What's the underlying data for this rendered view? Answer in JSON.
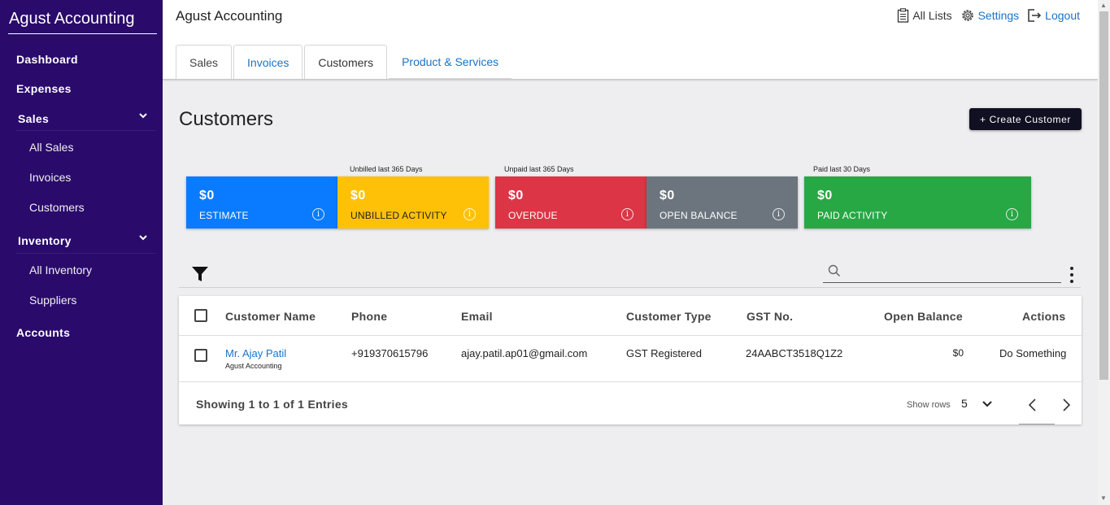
{
  "sidebar": {
    "brand": "Agust Accounting",
    "dashboard": "Dashboard",
    "expenses": "Expenses",
    "sales": {
      "label": "Sales",
      "items": [
        "All Sales",
        "Invoices",
        "Customers"
      ]
    },
    "inventory": {
      "label": "Inventory",
      "items": [
        "All Inventory",
        "Suppliers"
      ]
    },
    "accounts": "Accounts"
  },
  "header": {
    "title": "Agust Accounting",
    "all_lists": "All Lists",
    "settings": "Settings",
    "logout": "Logout",
    "tabs": [
      "Sales",
      "Invoices",
      "Customers",
      "Product & Services"
    ],
    "active_tab": "Customers"
  },
  "main": {
    "title": "Customers",
    "create_button": "+ Create Customer",
    "cards": [
      {
        "caption": "",
        "amount": "$0",
        "label": "ESTIMATE",
        "color": "#0a7bff"
      },
      {
        "caption": "Unbilled last 365 Days",
        "amount": "$0",
        "label": "UNBILLED ACTIVITY",
        "color": "#ffc107"
      },
      {
        "caption": "Unpaid last 365 Days",
        "amount": "$0",
        "label": "OVERDUE",
        "color": "#dc3545"
      },
      {
        "caption": "",
        "amount": "$0",
        "label": "OPEN BALANCE",
        "color": "#6c757d"
      },
      {
        "caption": "Paid last 30 Days",
        "amount": "$0",
        "label": "PAID ACTIVITY",
        "color": "#28a745"
      }
    ],
    "info_glyph": "i",
    "search": {
      "placeholder": "",
      "value": ""
    }
  },
  "table": {
    "columns": [
      "Customer Name",
      "Phone",
      "Email",
      "Customer Type",
      "GST No.",
      "Open Balance",
      "Actions"
    ],
    "rows": [
      {
        "name": "Mr. Ajay Patil",
        "company": "Agust Accounting",
        "phone": "+919370615796",
        "email": "ajay.patil.ap01@gmail.com",
        "type": "GST Registered",
        "gst": "24AABCT3518Q1Z2",
        "balance": "$0",
        "action": "Do Something"
      }
    ],
    "footer": "Showing 1 to 1 of 1 Entries",
    "show_rows_label": "Show rows",
    "rows_per_page": "5"
  },
  "icons": {
    "chevron": "chevron-down-icon",
    "list": "clipboard-list-icon",
    "gear": "gear-icon",
    "logout": "logout-icon",
    "filter": "filter-icon",
    "search": "search-icon",
    "kebab": "more-vertical-icon"
  }
}
